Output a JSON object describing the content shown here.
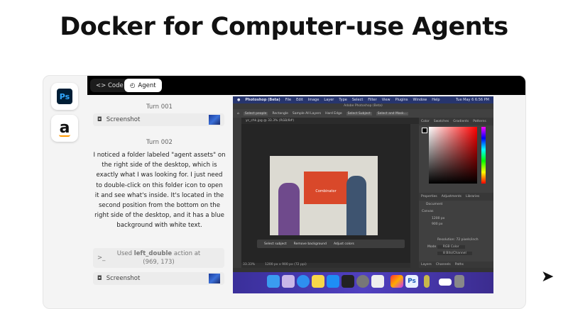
{
  "title": "Docker for Computer-use Agents",
  "apps": [
    {
      "name": "Adobe Photoshop",
      "label": "Ps"
    },
    {
      "name": "Amazon",
      "label": "a"
    }
  ],
  "tabs": {
    "code": "<> Code",
    "agent": "Agent",
    "active": "agent"
  },
  "turns": [
    {
      "label": "Turn 001",
      "screenshot_label": "Screenshot"
    },
    {
      "label": "Turn 002",
      "message": "I noticed a folder labeled \"agent assets\" on the right side of the desktop, which is exactly what I was looking for. I just need to double-click on this folder icon to open it and see what's inside. It's located in the second position from the bottom on the right side of the desktop, and it has a blue background with white text.",
      "action_prefix": "Used ",
      "action_name": "left_double",
      "action_suffix": " action at (969, 173)",
      "screenshot_label": "Screenshot"
    }
  ],
  "photoshop": {
    "menu": [
      "Photoshop (Beta)",
      "File",
      "Edit",
      "Image",
      "Layer",
      "Type",
      "Select",
      "Filter",
      "View",
      "Plugins",
      "Window",
      "Help"
    ],
    "clock": "Tue May 6  6:56 PM",
    "window_title": "Adobe Photoshop (Beta)",
    "options": [
      "Select people",
      "Rectangle",
      "Sample All Layers",
      "Hard Edge",
      "Select Subject",
      "Select and Mask..."
    ],
    "doc_tab": "yc_chk.jpg @ 33.3% (RGB/8#)",
    "panel_tabs": [
      "Color",
      "Swatches",
      "Gradients",
      "Patterns"
    ],
    "props_tabs": [
      "Properties",
      "Adjustments",
      "Libraries"
    ],
    "props": {
      "section": "Canvas",
      "doc": "Document",
      "w": "1200 px",
      "h": "900 px",
      "resolution": "Resolution: 72 pixels/inch",
      "mode_label": "Mode",
      "mode": "RGB Color",
      "depth": "8 Bits/Channel"
    },
    "layers_tabs": [
      "Layers",
      "Channels",
      "Paths"
    ],
    "context_bar": [
      "Select subject",
      "Remove background",
      "Adjust colors"
    ],
    "sign_text": "Combinator",
    "zoom": "33.33%",
    "status": "1200 px x 900 px (72 ppi)"
  },
  "colors": {
    "accent": "#000000",
    "menubar": "#27356e",
    "sign": "#d9482a"
  }
}
